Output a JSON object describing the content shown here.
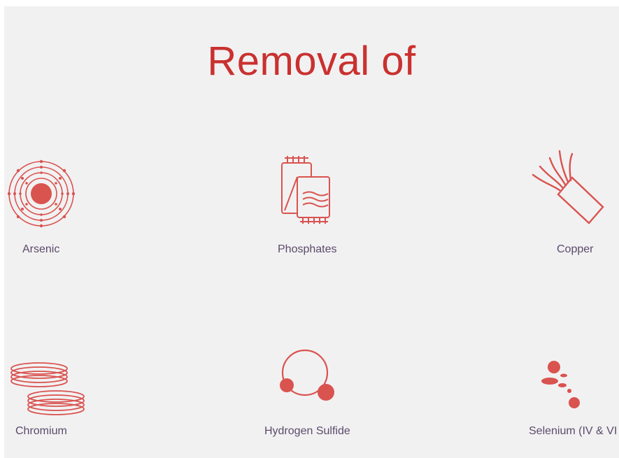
{
  "heading": {
    "title": "Removal of"
  },
  "accent_color": "#d9534f",
  "label_color": "#5a4a6a",
  "items": [
    {
      "label": "Arsenic",
      "icon": "atom-icon"
    },
    {
      "label": "Phosphates",
      "icon": "filter-pads-icon"
    },
    {
      "label": "Copper",
      "icon": "copper-wire-icon"
    },
    {
      "label": "Chromium",
      "icon": "coiled-rings-icon"
    },
    {
      "label": "Hydrogen Sulfide",
      "icon": "molecule-icon"
    },
    {
      "label": "Selenium (IV & VI",
      "icon": "particles-icon"
    }
  ]
}
